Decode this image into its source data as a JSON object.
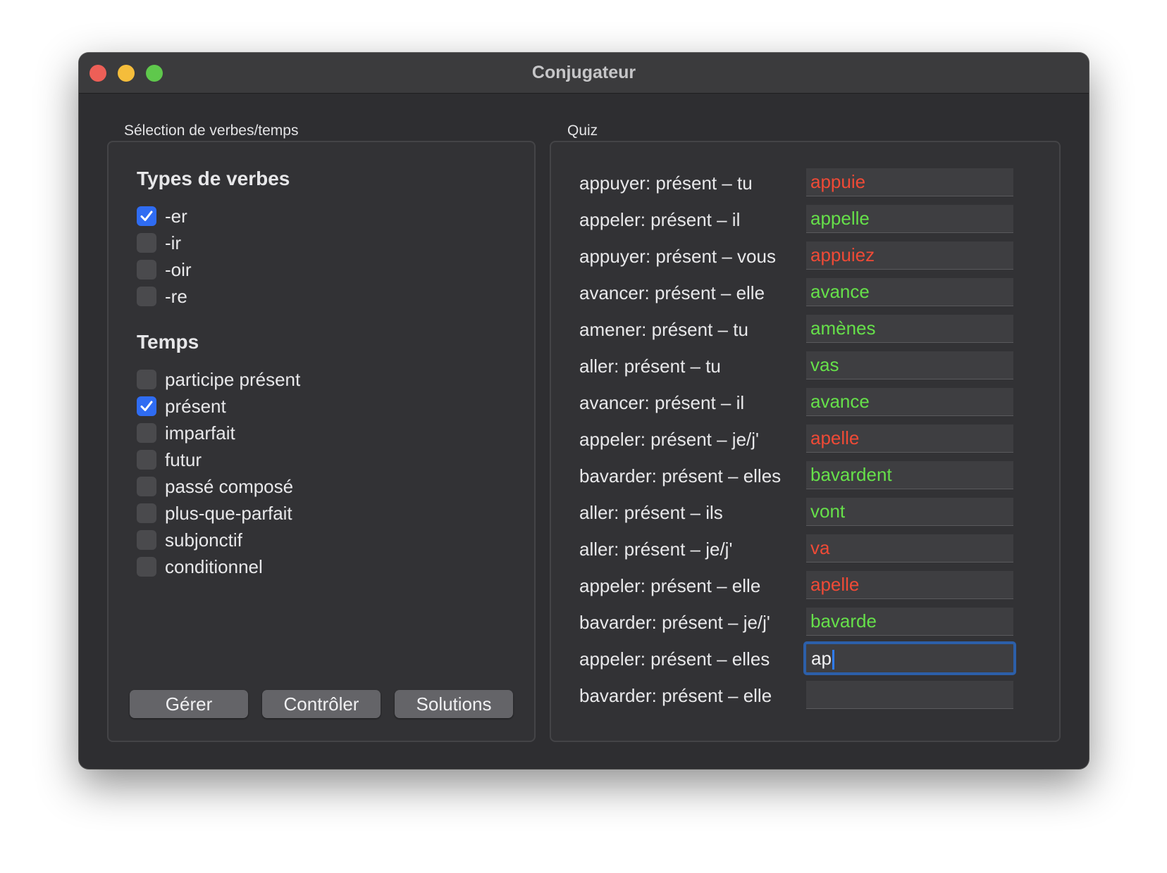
{
  "window": {
    "title": "Conjugateur",
    "traffic_lights": [
      "close",
      "minimize",
      "zoom"
    ]
  },
  "selection": {
    "group_label": "Sélection de verbes/temps",
    "verb_types_title": "Types de verbes",
    "verb_types": [
      {
        "label": "-er",
        "checked": true
      },
      {
        "label": "-ir",
        "checked": false
      },
      {
        "label": "-oir",
        "checked": false
      },
      {
        "label": "-re",
        "checked": false
      }
    ],
    "tenses_title": "Temps",
    "tenses": [
      {
        "label": "participe présent",
        "checked": false
      },
      {
        "label": "présent",
        "checked": true
      },
      {
        "label": "imparfait",
        "checked": false
      },
      {
        "label": "futur",
        "checked": false
      },
      {
        "label": "passé composé",
        "checked": false
      },
      {
        "label": "plus-que-parfait",
        "checked": false
      },
      {
        "label": "subjonctif",
        "checked": false
      },
      {
        "label": "conditionnel",
        "checked": false
      }
    ],
    "buttons": {
      "generate": "Gérer",
      "check": "Contrôler",
      "solutions": "Solutions"
    }
  },
  "quiz": {
    "group_label": "Quiz",
    "rows": [
      {
        "prompt": "appuyer: présent – tu",
        "answer": "appuie",
        "status": "wrong"
      },
      {
        "prompt": "appeler: présent – il",
        "answer": "appelle",
        "status": "correct"
      },
      {
        "prompt": "appuyer: présent – vous",
        "answer": "appuiez",
        "status": "wrong"
      },
      {
        "prompt": "avancer: présent – elle",
        "answer": "avance",
        "status": "correct"
      },
      {
        "prompt": "amener: présent – tu",
        "answer": "amènes",
        "status": "correct"
      },
      {
        "prompt": "aller: présent – tu",
        "answer": "vas",
        "status": "correct"
      },
      {
        "prompt": "avancer: présent – il",
        "answer": "avance",
        "status": "correct"
      },
      {
        "prompt": "appeler: présent – je/j'",
        "answer": "apelle",
        "status": "wrong"
      },
      {
        "prompt": "bavarder: présent – elles",
        "answer": "bavardent",
        "status": "correct"
      },
      {
        "prompt": "aller: présent – ils",
        "answer": "vont",
        "status": "correct"
      },
      {
        "prompt": "aller: présent – je/j'",
        "answer": "va",
        "status": "wrong"
      },
      {
        "prompt": "appeler: présent – elle",
        "answer": "apelle",
        "status": "wrong"
      },
      {
        "prompt": "bavarder: présent – je/j'",
        "answer": "bavarde",
        "status": "correct"
      },
      {
        "prompt": "appeler: présent – elles",
        "answer": "ap",
        "status": "editing"
      },
      {
        "prompt": "bavarder: présent – elle",
        "answer": "",
        "status": "empty"
      }
    ]
  },
  "colors": {
    "correct": "#66e04a",
    "wrong": "#ef4a36",
    "editing": "#f2f2f4",
    "accent": "#2f6cf2"
  }
}
